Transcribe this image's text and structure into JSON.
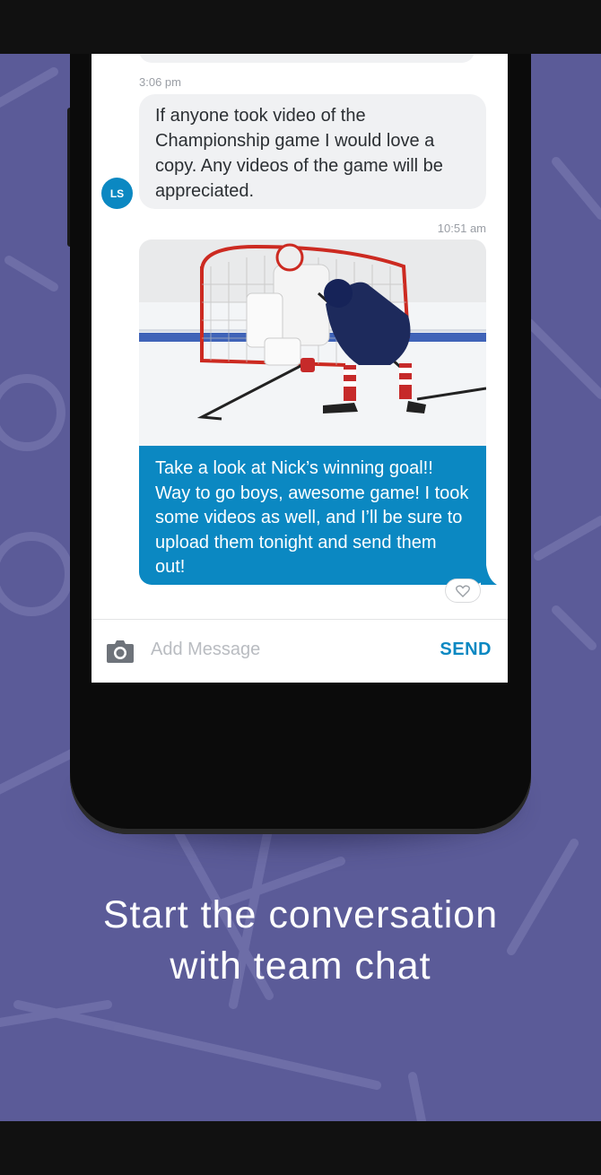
{
  "chat": {
    "messages": [
      {
        "time": "3:06 pm",
        "sender_initials": "LS",
        "text": "If anyone took video of the Championship game I would love a copy. Any videos of the game will be appreciated."
      },
      {
        "time": "10:51 am",
        "image": "hockey-goal-photo",
        "text": "Take a look at Nick’s winning goal!! Way to go boys, awesome game! I took some videos as well, and I’ll be sure to upload them tonight and send them out!"
      }
    ],
    "composer": {
      "placeholder": "Add Message",
      "send_label": "SEND"
    }
  },
  "headline": {
    "line1": "Start the conversation",
    "line2": "with team chat"
  },
  "colors": {
    "background": "#5b5b98",
    "accent": "#0b88c2",
    "incoming_bubble": "#f0f1f3"
  },
  "icons": [
    "camera-icon",
    "heart-icon"
  ]
}
